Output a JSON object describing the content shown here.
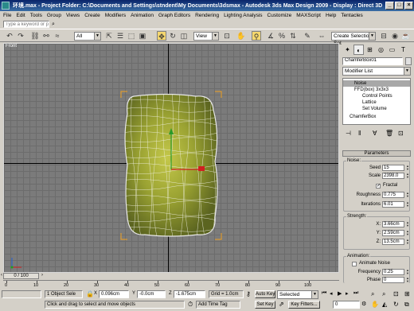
{
  "window": {
    "title": "环境.max   - Project Folder: C:\\Documents and Settings\\stndent\\My Documents\\3dsmax    - Autodesk 3ds Max Design 2009    - Display : Direct 3D",
    "minimize": "_",
    "maximize": "□",
    "close": "×"
  },
  "menu": [
    "File",
    "Edit",
    "Tools",
    "Group",
    "Views",
    "Create",
    "Modifiers",
    "Animation",
    "Graph Editors",
    "Rendering",
    "Lighting Analysis",
    "Customize",
    "MAXScript",
    "Help",
    "Tentacles"
  ],
  "search": {
    "placeholder": "Type a keyword or phrase"
  },
  "toolbar": {
    "selection_filter": "All",
    "ref_coord": "View",
    "named_selection": "Create Selection Set"
  },
  "viewport": {
    "label": "Front"
  },
  "command_panel": {
    "object_name": "ChamferBox01",
    "modifier_list": "Modifier List",
    "stack": [
      {
        "label": "Noise",
        "selected": true
      },
      {
        "label": "FFD(box) 3x3x3",
        "selected": false
      },
      {
        "label": "Control Points",
        "selected": false
      },
      {
        "label": "Lattice",
        "selected": false
      },
      {
        "label": "Set Volume",
        "selected": false
      },
      {
        "label": "ChamferBox",
        "selected": false
      }
    ],
    "parameters_title": "Parameters",
    "noise": {
      "group": "Noise:",
      "seed_label": "Seed",
      "seed_value": "15",
      "scale_label": "Scale",
      "scale_value": "2398.0",
      "fractal_label": "Fractal",
      "fractal_checked": true,
      "roughness_label": "Roughness",
      "roughness_value": "0.775",
      "iterations_label": "Iterations",
      "iterations_value": "6.01"
    },
    "strength": {
      "group": "Strength:",
      "x_label": "X:",
      "x_value": "3.66cm",
      "y_label": "Y:",
      "y_value": "2.59cm",
      "z_label": "Z:",
      "z_value": "13.5cm"
    },
    "animation": {
      "group": "Animation:",
      "animate_label": "Animate Noise",
      "frequency_label": "Frequency",
      "frequency_value": "0.25",
      "phase_label": "Phase",
      "phase_value": "0"
    }
  },
  "timeline": {
    "slider": "0 / 100",
    "ticks": [
      "0",
      "10",
      "20",
      "30",
      "40",
      "50",
      "60",
      "70",
      "80",
      "90",
      "100"
    ]
  },
  "status": {
    "selected": "1 Object Sele",
    "x_label": "X",
    "x_value": "0.096cm",
    "y_label": "Y",
    "y_value": "-0.0cm",
    "z_label": "Z",
    "z_value": "-1.675cm",
    "grid": "Grid = 1.0cm",
    "auto_key": "Auto Key",
    "key_mode": "Selected",
    "set_key": "Set Key",
    "key_filters": "Key Filters...",
    "prompt": "Click and drag to select and move objects",
    "add_time_tag": "Add Time Tag",
    "frame": "0"
  },
  "colors": {
    "titlebar": "#0a246a",
    "object_fill": "#9aa232",
    "selection_bracket": "#f0a020",
    "viewport_bg": "#7b7b7b"
  }
}
